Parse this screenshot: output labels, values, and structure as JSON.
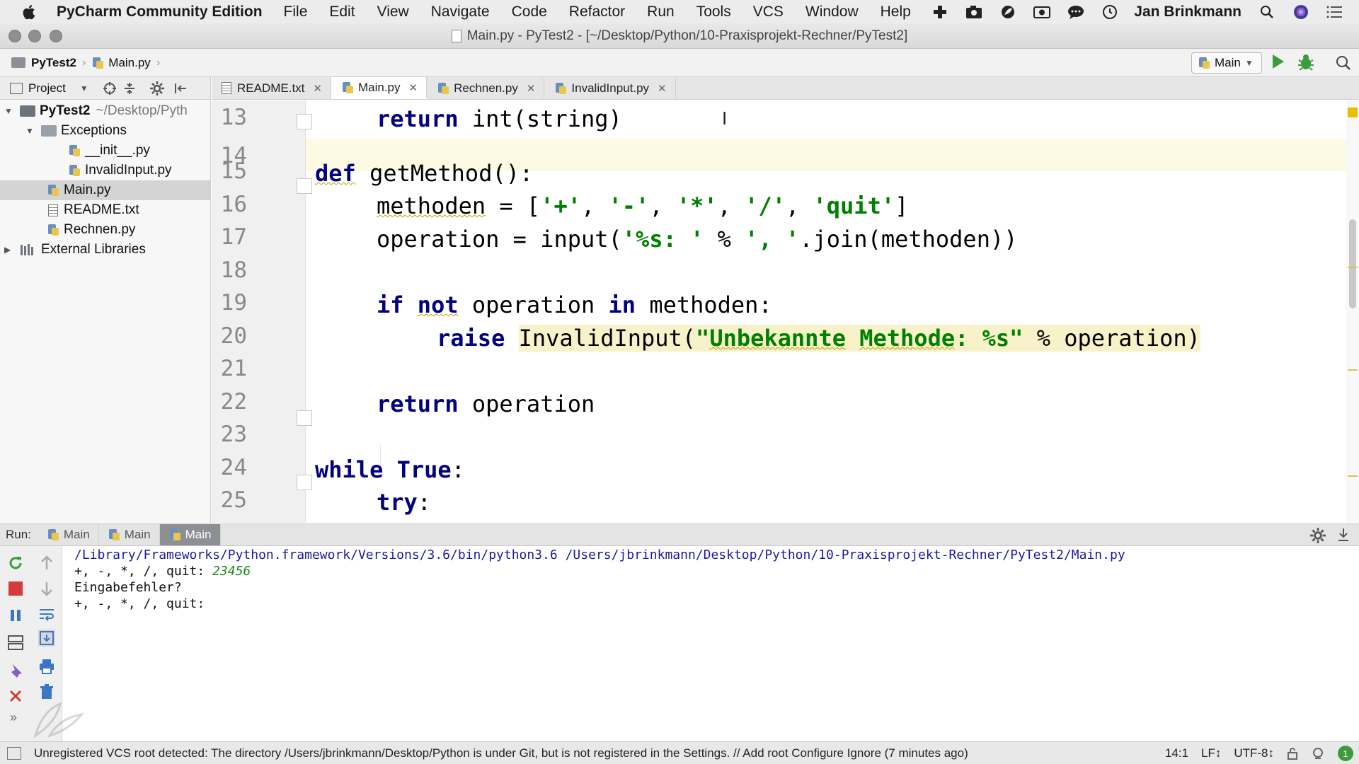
{
  "menubar": {
    "app_name": "PyCharm Community Edition",
    "items": [
      "File",
      "Edit",
      "View",
      "Navigate",
      "Code",
      "Refactor",
      "Run",
      "Tools",
      "VCS",
      "Window",
      "Help"
    ],
    "user_name": "Jan Brinkmann",
    "tray_icons": [
      "plugin-icon",
      "camera-icon",
      "leaf-icon",
      "video-icon",
      "chat-icon",
      "time-machine-icon"
    ]
  },
  "window": {
    "title": "Main.py - PyTest2 - [~/Desktop/Python/10-Praxisprojekt-Rechner/PyTest2]"
  },
  "navbar": {
    "breadcrumbs": [
      "PyTest2",
      "Main.py"
    ],
    "run_config": "Main"
  },
  "project_panel": {
    "label": "Project",
    "tree": [
      {
        "name": "PyTest2",
        "hint": "~/Desktop/Pyth",
        "icon": "folder-icon",
        "expanded": true
      },
      {
        "name": "Exceptions",
        "icon": "folder-icon",
        "expanded": true
      },
      {
        "name": "__init__.py",
        "icon": "python-file-icon"
      },
      {
        "name": "InvalidInput.py",
        "icon": "python-file-icon"
      },
      {
        "name": "Main.py",
        "icon": "python-file-icon",
        "selected": true
      },
      {
        "name": "README.txt",
        "icon": "text-file-icon"
      },
      {
        "name": "Rechnen.py",
        "icon": "python-file-icon"
      },
      {
        "name": "External Libraries",
        "icon": "library-icon",
        "expanded": false
      }
    ]
  },
  "tabs": [
    {
      "label": "README.txt",
      "icon": "text-file-icon"
    },
    {
      "label": "Main.py",
      "icon": "python-file-icon",
      "active": true
    },
    {
      "label": "Rechnen.py",
      "icon": "python-file-icon"
    },
    {
      "label": "InvalidInput.py",
      "icon": "python-file-icon"
    }
  ],
  "editor": {
    "line_numbers": [
      "13",
      "14",
      "15",
      "16",
      "17",
      "18",
      "19",
      "20",
      "21",
      "22",
      "23",
      "24",
      "25"
    ],
    "code": {
      "l13_kw": "return",
      "l13_rest": " int(string)",
      "l15_kw": "def",
      "l15_rest": " getMethod():",
      "l16_a": "methoden",
      "l16_b": " = [",
      "l16_s1": "'+'",
      "l16_c1": ", ",
      "l16_s2": "'-'",
      "l16_c2": ", ",
      "l16_s3": "'*'",
      "l16_c3": ", ",
      "l16_s4": "'/'",
      "l16_c4": ", ",
      "l16_s5": "'quit'",
      "l16_end": "]",
      "l17_a": "operation = input(",
      "l17_s1": "'%s: '",
      "l17_b": " % ",
      "l17_s2": "', '",
      "l17_c": ".join(methoden))",
      "l19_kw1": "if",
      "l19_kw2": "not",
      "l19_mid": " operation ",
      "l19_kw3": "in",
      "l19_end": " methoden:",
      "l20_kw": "raise",
      "l20_a": "InvalidInput(",
      "l20_s1": "\"",
      "l20_s2": "Unbekannte",
      "l20_s3": " ",
      "l20_s4": "Methode",
      "l20_s5": ": %s\"",
      "l20_b": " % operation)",
      "l22_kw": "return",
      "l22_rest": " operation",
      "l24_kw1": "while",
      "l24_kw2": "True",
      "l24_end": ":",
      "l25_kw": "try",
      "l25_end": ":"
    }
  },
  "run_panel": {
    "label": "Run:",
    "tabs": [
      "Main",
      "Main",
      "Main"
    ],
    "console": {
      "line1": "/Library/Frameworks/Python.framework/Versions/3.6/bin/python3.6 /Users/jbrinkmann/Desktop/Python/10-Praxisprojekt-Rechner/PyTest2/Main.py",
      "line2_prompt": "+, -, *, /, quit: ",
      "line2_input": "23456",
      "line3": "Eingabefehler?",
      "line4": "+, -, *, /, quit:"
    }
  },
  "statusbar": {
    "message": "Unregistered VCS root detected: The directory /Users/jbrinkmann/Desktop/Python is under Git, but is not registered in the Settings. // Add root  Configure  Ignore (7 minutes ago)",
    "position": "14:1",
    "line_separator": "LF↕",
    "encoding": "UTF-8↕",
    "badge": "1"
  },
  "colors": {
    "keyword": "#000080",
    "string": "#008000",
    "current_line": "#fcfae2",
    "run_button": "#3a9c3a",
    "stop_button": "#d63b3b"
  }
}
